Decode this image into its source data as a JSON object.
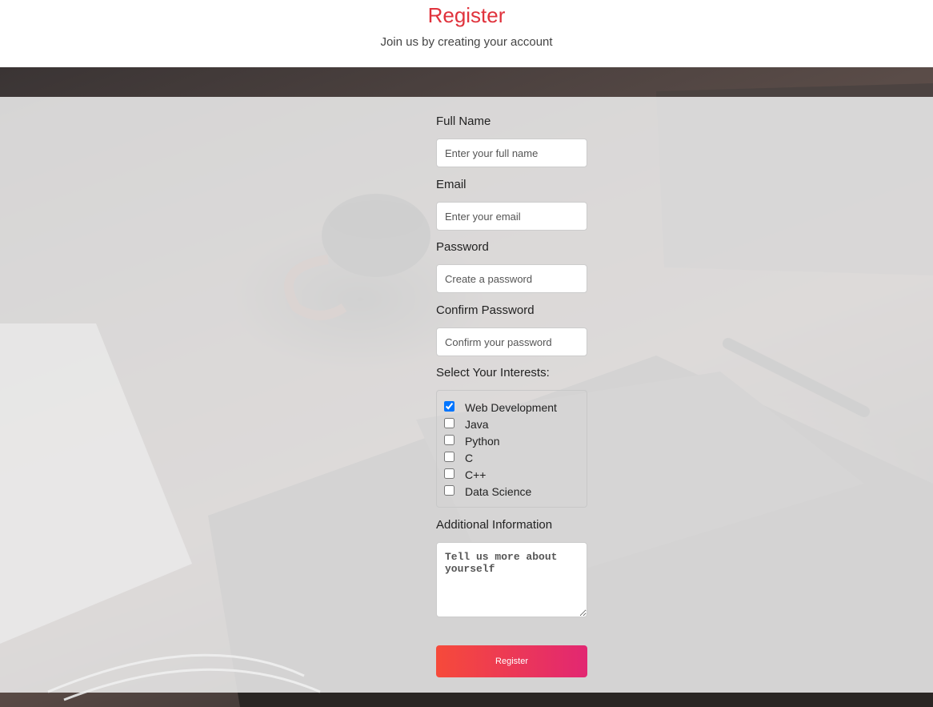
{
  "header": {
    "title": "Register",
    "subtitle": "Join us by creating your account"
  },
  "form": {
    "full_name": {
      "label": "Full Name",
      "placeholder": "Enter your full name"
    },
    "email": {
      "label": "Email",
      "placeholder": "Enter your email"
    },
    "password": {
      "label": "Password",
      "placeholder": "Create a password"
    },
    "confirm_password": {
      "label": "Confirm Password",
      "placeholder": "Confirm your password"
    },
    "interests": {
      "label": "Select Your Interests:",
      "options": [
        {
          "label": "Web Development",
          "checked": true
        },
        {
          "label": "Java",
          "checked": false
        },
        {
          "label": "Python",
          "checked": false
        },
        {
          "label": "C",
          "checked": false
        },
        {
          "label": "C++",
          "checked": false
        },
        {
          "label": "Data Science",
          "checked": false
        }
      ]
    },
    "additional_info": {
      "label": "Additional Information",
      "placeholder": "Tell us more about yourself"
    },
    "submit_label": "Register"
  },
  "colors": {
    "title": "#e0323c",
    "button_gradient_start": "#f64a3a",
    "button_gradient_end": "#e22772"
  },
  "icons": {
    "background": "laptop-coffee-photo"
  }
}
